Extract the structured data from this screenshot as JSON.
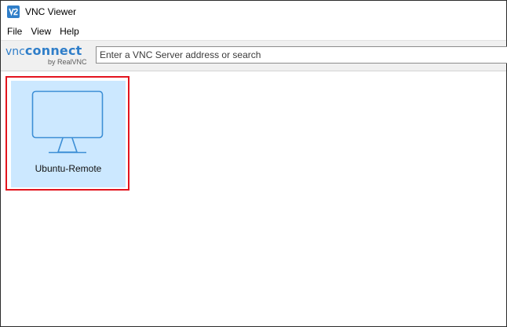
{
  "window": {
    "title": "VNC Viewer",
    "app_icon": "vnc-viewer-app-icon"
  },
  "menu": {
    "items": [
      {
        "label": "File"
      },
      {
        "label": "View"
      },
      {
        "label": "Help"
      }
    ]
  },
  "toolbar": {
    "brand_main_prefix": "vnc",
    "brand_main_suffix": "connect",
    "brand_sub": "by RealVNC",
    "search": {
      "value": "",
      "placeholder": "Enter a VNC Server address or search"
    }
  },
  "connections": [
    {
      "name": "Ubuntu-Remote",
      "icon": "monitor-icon",
      "selected": true,
      "highlighted": true
    }
  ],
  "colors": {
    "accent": "#2f7ec9",
    "tile_selected": "#cce8ff",
    "highlight_border": "#e3141e",
    "toolbar_bg": "#f0f0f0"
  }
}
